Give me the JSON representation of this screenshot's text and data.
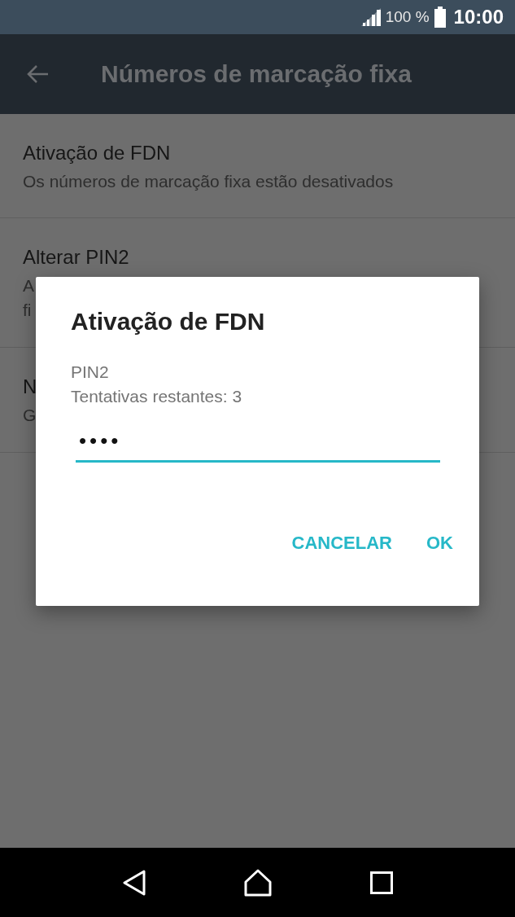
{
  "status_bar": {
    "battery": "100 %",
    "time": "10:00"
  },
  "toolbar": {
    "title": "Números de marcação fixa"
  },
  "settings": [
    {
      "title": "Ativação de FDN",
      "summary": [
        "Os números de marcação fixa estão desativados"
      ]
    },
    {
      "title": "Alterar PIN2",
      "summary": [
        "A",
        "fi"
      ]
    },
    {
      "title": "N",
      "summary": [
        "G"
      ]
    }
  ],
  "dialog": {
    "title": "Ativação de FDN",
    "label": "PIN2",
    "hint": "Tentativas restantes: 3",
    "value": "••••",
    "buttons": [
      "CANCELAR",
      "OK"
    ]
  }
}
